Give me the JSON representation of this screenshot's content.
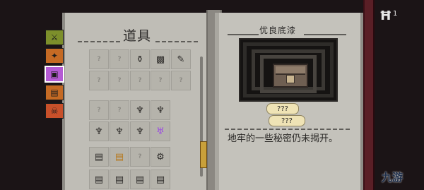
{
  "inventory": {
    "title": "道具",
    "tabs": [
      {
        "name": "tab-equipment",
        "icon": "sword-icon",
        "color": "#7d8f2b"
      },
      {
        "name": "tab-weapons",
        "icon": "gun-icon",
        "color": "#c56a24"
      },
      {
        "name": "tab-items",
        "icon": "chest-icon",
        "color": "#b55bd4",
        "selected": true
      },
      {
        "name": "tab-scrolls",
        "icon": "scroll-icon",
        "color": "#c56a24"
      },
      {
        "name": "tab-bosses",
        "icon": "skull-icon",
        "color": "#c8502a"
      }
    ],
    "slot_unknown": "?"
  },
  "detail": {
    "title": "优良底漆",
    "reveal_buttons": [
      "???",
      "???"
    ],
    "description": "地牢的一些秘密仍未揭开。"
  },
  "hud": {
    "hp_icon": "hp-icon",
    "hp_count": "1"
  },
  "watermark": "九游"
}
